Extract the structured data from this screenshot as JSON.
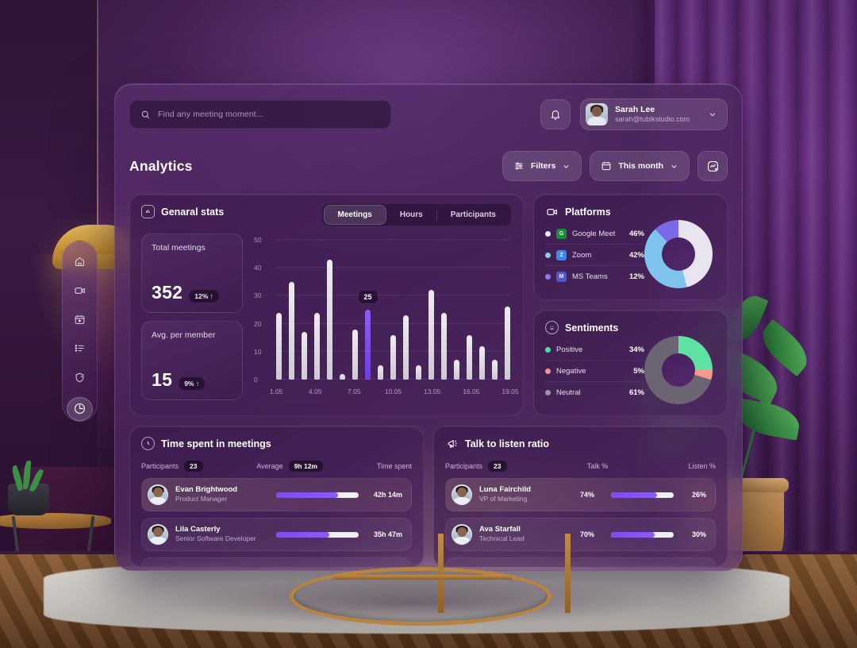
{
  "app": {
    "page_title": "Analytics"
  },
  "search": {
    "placeholder": "Find any meeting moment...",
    "icon": "search-icon"
  },
  "header": {
    "notification_icon": "bell-icon",
    "user": {
      "name": "Sarah Lee",
      "email": "sarah@tubikstudio.com",
      "avatar": "user-avatar",
      "chevron": "chevron-down-icon"
    }
  },
  "controls": {
    "filters_label": "Filters",
    "filters_icon": "sliders-icon",
    "period_label": "This month",
    "period_icon": "calendar-icon",
    "export_icon": "report-chart-icon"
  },
  "sidebar": {
    "items": [
      {
        "name": "home",
        "icon": "home-icon",
        "active": false
      },
      {
        "name": "meetings",
        "icon": "video-camera-icon",
        "active": false
      },
      {
        "name": "recordings",
        "icon": "calendar-play-icon",
        "active": false
      },
      {
        "name": "tasks",
        "icon": "list-icon",
        "active": false
      },
      {
        "name": "insights",
        "icon": "shield-sparkle-icon",
        "active": false
      },
      {
        "name": "analytics",
        "icon": "clock-pie-icon",
        "active": true
      }
    ]
  },
  "general_stats": {
    "title": "Genaral stats",
    "icon": "bar-chart-icon",
    "tabs": [
      {
        "label": "Meetings",
        "active": true
      },
      {
        "label": "Hours",
        "active": false
      },
      {
        "label": "Participants",
        "active": false
      }
    ],
    "stats": [
      {
        "label": "Total meetings",
        "value": "352",
        "delta": "12% ↑"
      },
      {
        "label": "Avg. per member",
        "value": "15",
        "delta": "9% ↑"
      }
    ]
  },
  "chart_data": {
    "type": "bar",
    "title": "Genaral stats",
    "xlabel": "",
    "ylabel": "",
    "ylim": [
      0,
      50
    ],
    "yticks": [
      0,
      10,
      20,
      30,
      40,
      50
    ],
    "grid": true,
    "legend": "none",
    "categories": [
      "1.05",
      "",
      "",
      "4.05",
      "",
      "",
      "7.05",
      "",
      "",
      "10.05",
      "",
      "",
      "13.05",
      "",
      "",
      "16.05",
      "",
      "",
      "19.05"
    ],
    "tick_labels": [
      "1.05",
      "4.05",
      "7.05",
      "10.05",
      "13.05",
      "16.05",
      "19.05"
    ],
    "values": [
      24,
      35,
      17,
      24,
      43,
      2,
      18,
      25,
      5,
      16,
      23,
      5,
      32,
      24,
      7,
      16,
      12,
      7,
      26
    ],
    "highlight_index": 7,
    "highlight_value": "25",
    "bar_color": "#e4dee9",
    "highlight_color": "#7c4de8"
  },
  "platforms": {
    "title": "Platforms",
    "icon": "video-camera-icon",
    "rows": [
      {
        "name": "Google Meet",
        "value": "46%",
        "dot": "#efe9f2",
        "app_icon": "google-meet-icon",
        "app_color": "#1b8a3c"
      },
      {
        "name": "Zoom",
        "value": "42%",
        "dot": "#8fc9f2",
        "app_icon": "zoom-icon",
        "app_color": "#2d8cff"
      },
      {
        "name": "MS Teams",
        "value": "12%",
        "dot": "#8b77f0",
        "app_icon": "ms-teams-icon",
        "app_color": "#5059c9"
      }
    ],
    "donut": {
      "type": "pie",
      "labels": [
        "Google Meet",
        "Zoom",
        "MS Teams"
      ],
      "values": [
        46,
        42,
        12
      ],
      "colors": [
        "#e9e5ee",
        "#7fc4ef",
        "#7b6ae8"
      ]
    }
  },
  "sentiments": {
    "title": "Sentiments",
    "icon": "smiley-icon",
    "rows": [
      {
        "name": "Positive",
        "value": "34%",
        "dot": "#4fe0a0"
      },
      {
        "name": "Negative",
        "value": "5%",
        "dot": "#f2968a"
      },
      {
        "name": "Neutral",
        "value": "61%",
        "dot": "#9b93a6"
      }
    ],
    "donut": {
      "type": "pie",
      "labels": [
        "Positive",
        "Negative",
        "Neutral"
      ],
      "values": [
        34,
        5,
        61
      ],
      "colors": [
        "#5fe3a5",
        "#f4998c",
        "#6b6573"
      ]
    }
  },
  "time_spent": {
    "title": "Time spent in meetings",
    "icon": "clock-icon",
    "participants_label": "Participants",
    "participants_count": "23",
    "average_label": "Average",
    "average_value": "9h 12m",
    "time_spent_label": "Time spent",
    "rows": [
      {
        "name": "Evan Brightwood",
        "role": "Product Manager",
        "fill_pct": 75,
        "value": "42h 14m"
      },
      {
        "name": "Lila Casterly",
        "role": "Senior Software Developer",
        "fill_pct": 64,
        "value": "35h 47m"
      }
    ]
  },
  "talk_listen": {
    "title": "Talk to listen ratio",
    "icon": "megaphone-icon",
    "participants_label": "Participants",
    "participants_count": "23",
    "talk_label": "Talk %",
    "listen_label": "Listen %",
    "rows": [
      {
        "name": "Luna Fairchild",
        "role": "VP of Marketing",
        "talk": "74%",
        "listen": "26%",
        "fill_pct": 74
      },
      {
        "name": "Ava Starfall",
        "role": "Technical Lead",
        "talk": "70%",
        "listen": "30%",
        "fill_pct": 70
      }
    ]
  },
  "colors": {
    "accent": "#7c4de8",
    "panel": "#56306c",
    "positive": "#5fe3a5",
    "negative": "#f4998c",
    "neutral": "#6b6573"
  }
}
